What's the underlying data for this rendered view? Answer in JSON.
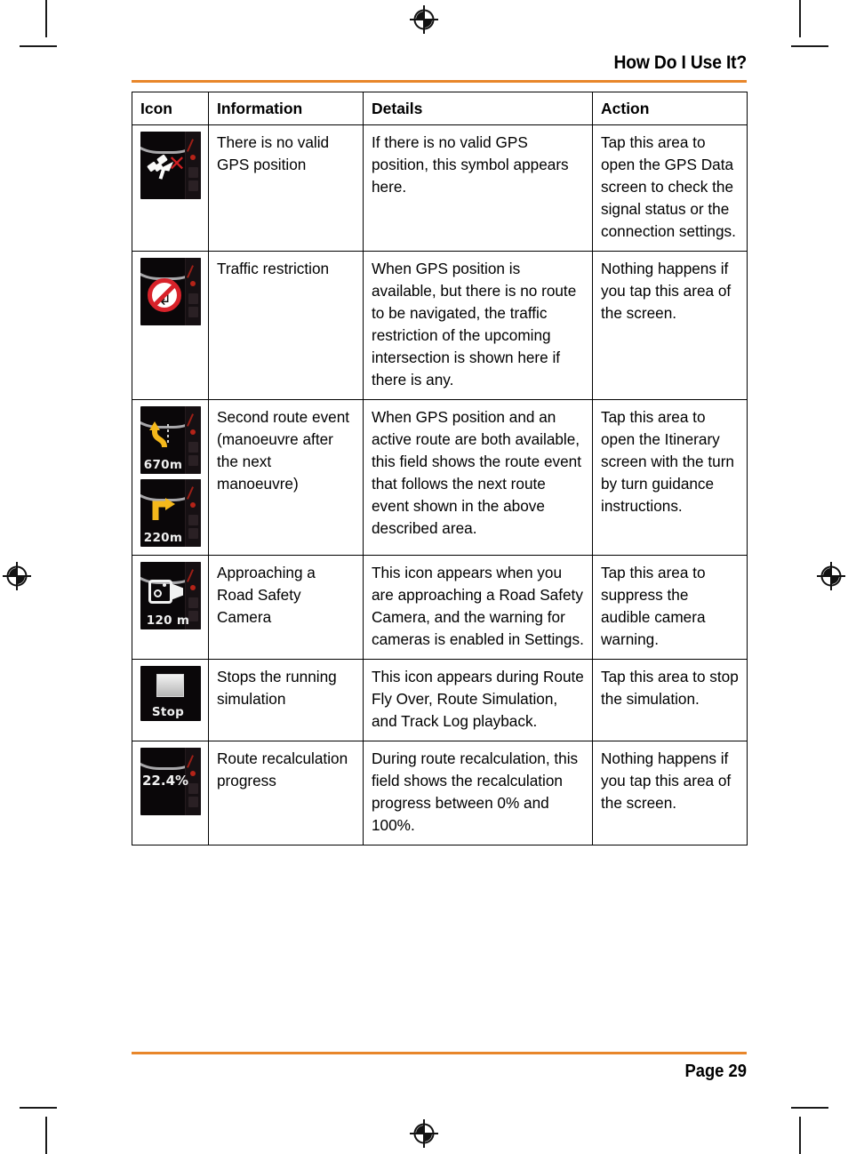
{
  "header": {
    "title": "How Do I Use It?"
  },
  "footer": {
    "page_label": "Page 29"
  },
  "table": {
    "columns": [
      "Icon",
      "Information",
      "Details",
      "Action"
    ],
    "rows": [
      {
        "icon": {
          "name": "no-gps-position-icon",
          "caption": "",
          "glyph": "satellite-with-red-x"
        },
        "information": "There is no valid GPS position",
        "details": "If there is no valid GPS position, this symbol appears here.",
        "action": "Tap this area to open the GPS Data screen to check the signal status or the connection settings."
      },
      {
        "icon": {
          "name": "traffic-restriction-icon",
          "caption": "",
          "glyph": "no-left-turn-sign"
        },
        "information": "Traffic restriction",
        "details": "When GPS position is available, but there is no route to be navigated, the traffic restriction of the upcoming intersection is shown here if there is any.",
        "action": "Nothing happens if you tap this area of the screen."
      },
      {
        "icon": {
          "name": "second-route-event-icon",
          "caption": "670m",
          "caption2": "220m",
          "glyph": "yellow-turn-arrow"
        },
        "information": "Second route event (manoeuvre after the next manoeuvre)",
        "details": "When GPS position and an active route are both available, this field shows the route event that follows the next route event shown in the above described area.",
        "action": "Tap this area to open the Itinerary screen with the turn by turn guidance instructions."
      },
      {
        "icon": {
          "name": "road-safety-camera-icon",
          "caption": "120 m",
          "glyph": "camera"
        },
        "information": "Approaching a Road Safety Camera",
        "details": "This icon appears when you are approaching a Road Safety Camera, and the warning for cameras is enabled in Settings.",
        "action": "Tap this area to suppress the audible camera warning."
      },
      {
        "icon": {
          "name": "stop-simulation-icon",
          "caption": "Stop",
          "glyph": "stop-square"
        },
        "information": "Stops the running simulation",
        "details": "This icon appears during Route Fly Over, Route Simulation, and Track Log playback.",
        "action": "Tap this area to stop the simulation."
      },
      {
        "icon": {
          "name": "route-recalculation-progress-icon",
          "caption": "22.4%",
          "glyph": "percentage-readout"
        },
        "information": "Route recalculation progress",
        "details": "During route recalculation, this field shows the recalculation progress between 0% and 100%.",
        "action": "Nothing happens if you tap this area of the screen."
      }
    ]
  },
  "colors": {
    "accent_rule": "#e8862a",
    "text": "#000000",
    "device_background": "#0a0709",
    "manoeuvre_arrow": "#f5b81b",
    "restriction_red": "#d8222a"
  }
}
